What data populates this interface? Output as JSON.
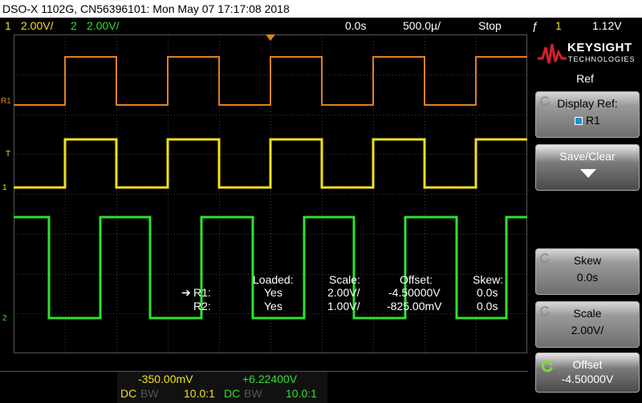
{
  "title_bar": "DSO-X 1102G, CN56396101: Mon May 07 17:17:08 2018",
  "status": {
    "ch1_num": "1",
    "ch1_scale": "2.00V/",
    "ch2_num": "2",
    "ch2_scale": "2.00V/",
    "delay": "0.0s",
    "timebase": "500.0µ/",
    "run_state": "Stop",
    "trigger_icon": "ƒ",
    "trigger_ch": "1",
    "trigger_level": "1.12V"
  },
  "markers": {
    "r1": "R1",
    "t": "T",
    "ch1": "1",
    "ch2": "2"
  },
  "ref_table": {
    "headers": [
      "Loaded:",
      "Scale:",
      "Offset:",
      "Skew:"
    ],
    "rows": [
      {
        "name": "R1:",
        "loaded": "Yes",
        "scale": "2.00V/",
        "offset": "-4.50000V",
        "skew": "0.0s",
        "selected": true
      },
      {
        "name": "R2:",
        "loaded": "Yes",
        "scale": "1.00V/",
        "offset": "-825.00mV",
        "skew": "0.0s",
        "selected": false
      }
    ]
  },
  "logo": {
    "brand": "KEYSIGHT",
    "sub": "TECHNOLOGIES"
  },
  "menu": {
    "title": "Ref",
    "softkeys": [
      {
        "label": "Display Ref:",
        "value": "R1"
      },
      {
        "label": "Save/Clear",
        "value": ""
      },
      {
        "label": "Skew",
        "value": "0.0s"
      },
      {
        "label": "Scale",
        "value": "2.00V/"
      },
      {
        "label": "Offset",
        "value": "-4.50000V"
      }
    ]
  },
  "bottom": {
    "ch1_offset": "-350.00mV",
    "ch2_offset": "+6.22400V",
    "ch1_coupling": "DC",
    "ch1_bw": "BW",
    "ch1_probe": "10.0:1",
    "ch2_coupling": "DC",
    "ch2_bw": "BW",
    "ch2_probe": "10.0:1"
  },
  "colors": {
    "ch1": "#f0e020",
    "ch2": "#30e030",
    "ref1": "#e08020",
    "grid": "#3a3a3a",
    "accent": "#d4202a"
  }
}
